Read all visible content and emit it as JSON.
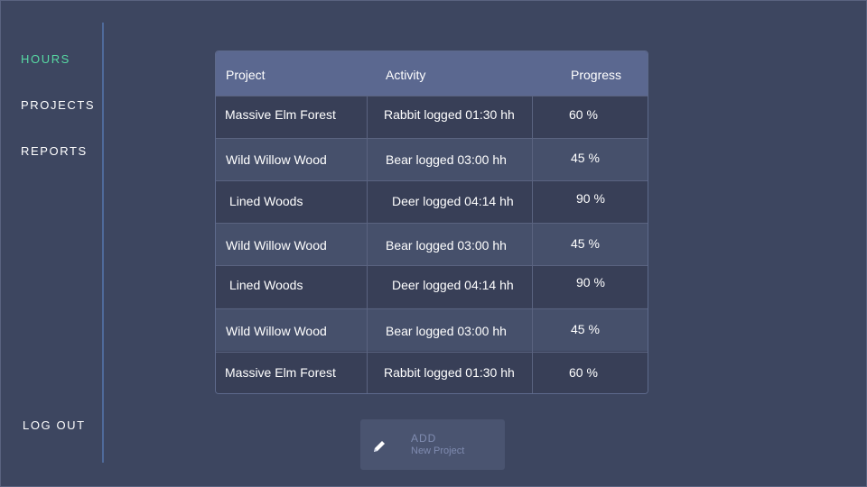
{
  "colors": {
    "background": "#3d4660",
    "accent_active": "#57d9a3",
    "header_bg": "#5b6890",
    "divider": "#4f6a9a"
  },
  "sidebar": {
    "items": [
      {
        "label": "HOURS",
        "active": true
      },
      {
        "label": "PROJECTS",
        "active": false
      },
      {
        "label": "REPORTS",
        "active": false
      }
    ],
    "logout_label": "LOG OUT"
  },
  "table": {
    "columns": [
      "Project",
      "Activity",
      "Progress"
    ],
    "rows": [
      {
        "project": "Massive Elm Forest",
        "activity": "Rabbit logged 01:30 hh",
        "progress": "60 %"
      },
      {
        "project": "Wild Willow Wood",
        "activity": "Bear logged 03:00 hh",
        "progress": "45 %"
      },
      {
        "project": "Lined Woods",
        "activity": "Deer logged 04:14 hh",
        "progress": "90 %"
      },
      {
        "project": "Wild Willow Wood",
        "activity": "Bear logged 03:00 hh",
        "progress": "45 %"
      },
      {
        "project": "Lined Woods",
        "activity": "Deer logged 04:14 hh",
        "progress": "90 %"
      },
      {
        "project": "Wild Willow Wood",
        "activity": "Bear logged 03:00 hh",
        "progress": "45 %"
      },
      {
        "project": "Massive Elm Forest",
        "activity": "Rabbit logged 01:30 hh",
        "progress": "60 %"
      }
    ]
  },
  "add_button": {
    "title": "ADD",
    "subtitle": "New Project",
    "icon": "pencil-icon"
  }
}
